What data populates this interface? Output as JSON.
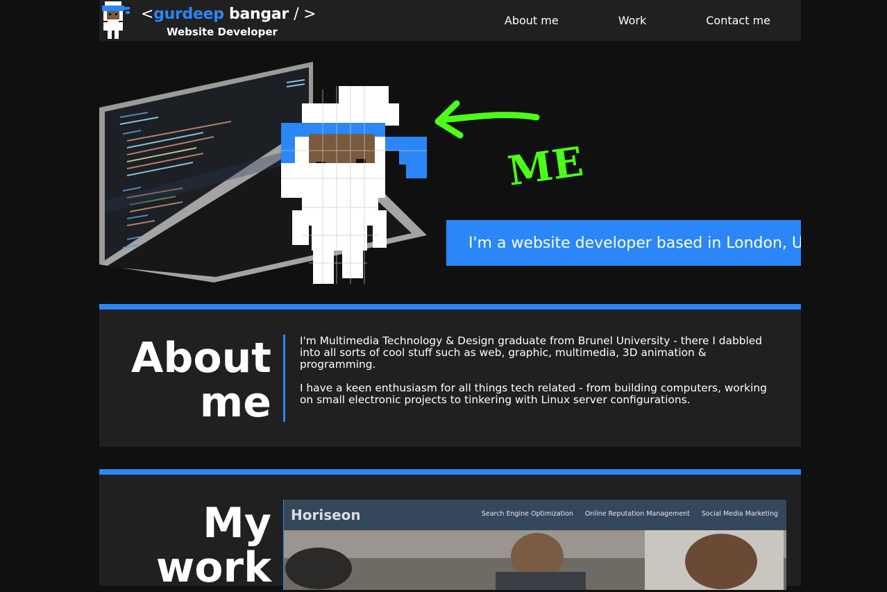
{
  "header": {
    "logo": {
      "bracket_open": "<",
      "first_name": "gurdeep",
      "last_name": "bangar",
      "bracket_close": "/ >",
      "subtitle": "Website Developer"
    },
    "nav": [
      {
        "label": "About me"
      },
      {
        "label": "Work"
      },
      {
        "label": "Contact me"
      }
    ]
  },
  "hero": {
    "annotation": "ME",
    "tagline": "I'm a website developer based in London, UK"
  },
  "about": {
    "title_line1": "About",
    "title_line2": "me",
    "paragraphs": [
      "I'm Multimedia Technology & Design graduate from Brunel University - there I dabbled into all sorts of cool stuff such as web, graphic, multimedia, 3D animation & programming.",
      "I have a keen enthusiasm for all things tech related - from building computers, working on small electronic projects to tinkering with Linux server configurations."
    ]
  },
  "work": {
    "title_line1": "My",
    "title_line2": "work",
    "project": {
      "brand": "Horiseon",
      "links": [
        "Search Engine Optimization",
        "Online Reputation Management",
        "Social Media Marketing"
      ]
    }
  },
  "colors": {
    "accent": "#2b86f7",
    "panel": "#202020",
    "background": "#101010",
    "annotation": "#4cff18"
  }
}
